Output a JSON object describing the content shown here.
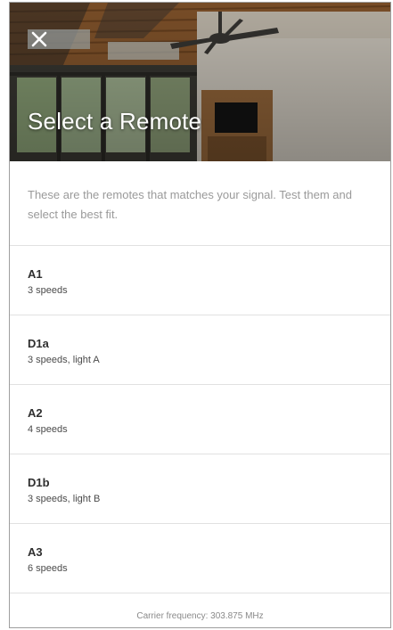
{
  "header": {
    "close_icon": "close-icon",
    "title": "Select a Remote"
  },
  "intro": {
    "text": "These are the remotes that matches your signal. Test them and select the best fit."
  },
  "remotes": [
    {
      "name": "A1",
      "description": "3 speeds"
    },
    {
      "name": "D1a",
      "description": "3 speeds, light A"
    },
    {
      "name": "A2",
      "description": "4 speeds"
    },
    {
      "name": "D1b",
      "description": "3 speeds, light B"
    },
    {
      "name": "A3",
      "description": "6 speeds"
    }
  ],
  "footer": {
    "carrier_frequency": "Carrier frequency: 303.875 MHz"
  },
  "colors": {
    "title_text": "#ffffff",
    "intro_text": "#9a9a9a",
    "item_name": "#2f2f2f",
    "divider": "#e1e1e1"
  }
}
